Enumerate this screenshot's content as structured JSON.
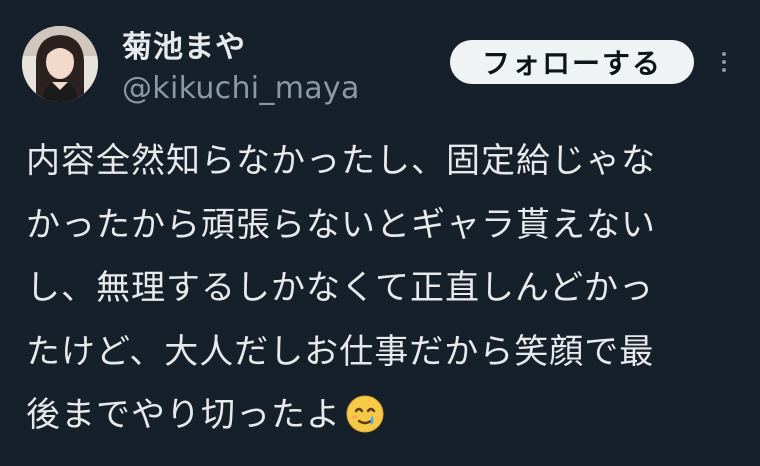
{
  "user": {
    "display_name": "菊池まや",
    "handle": "@kikuchi_maya"
  },
  "actions": {
    "follow_label": "フォローする",
    "more_icon": "more-vertical-icon"
  },
  "tweet": {
    "lines": [
      "内容全然知らなかったし、固定給じゃな",
      "かったから頑張らないとギャラ貰えない",
      "し、無理するしかなくて正直しんどかっ",
      "たけど、大人だしお仕事だから笑顔で最",
      "後までやり切ったよ"
    ],
    "trailing_emoji": "smiling-face-with-tear-emoji"
  },
  "colors": {
    "background": "#15202b",
    "text_primary": "#e7e9ea",
    "text_secondary": "#8b98a5",
    "follow_bg": "#eff3f4",
    "follow_text": "#0f1419"
  }
}
